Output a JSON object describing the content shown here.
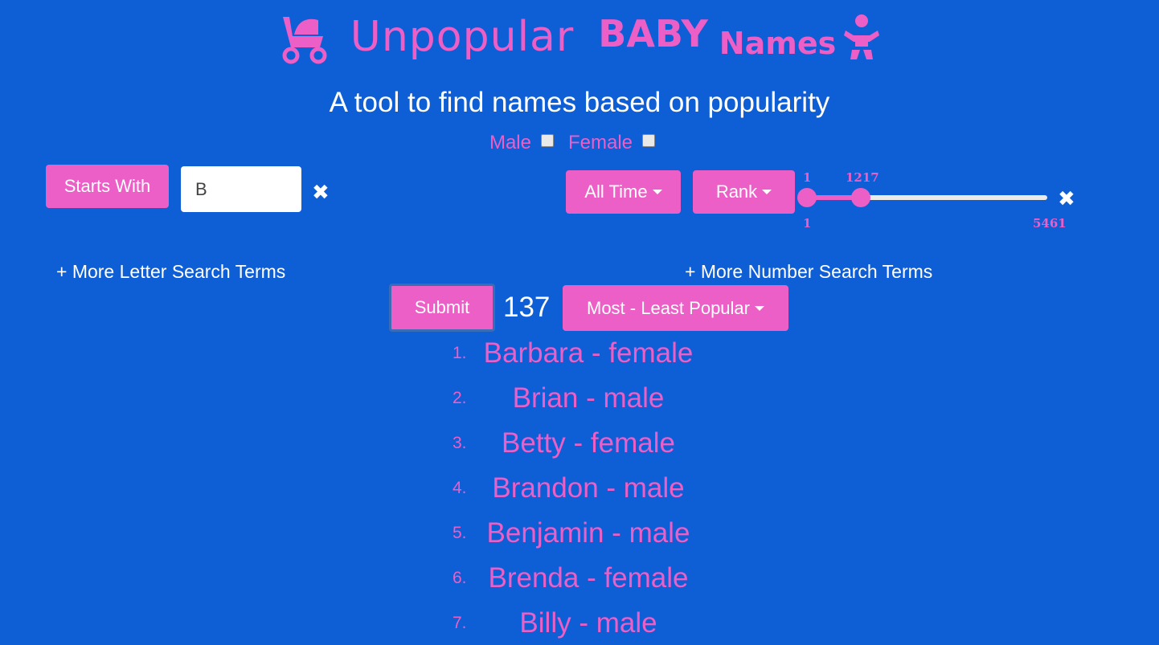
{
  "header": {
    "logo_word1": "Unpopular",
    "logo_word2": "BABY",
    "logo_word3": "Names",
    "subtitle": "A tool to find names based on popularity"
  },
  "gender": {
    "male_label": "Male",
    "female_label": "Female",
    "male_checked": false,
    "female_checked": false
  },
  "letter_search": {
    "mode_label": "Starts With",
    "value": "B",
    "clear_icon": "✖",
    "more_link": "+ More Letter Search Terms"
  },
  "number_search": {
    "period_label": "All Time",
    "metric_label": "Rank",
    "range_low": "1",
    "range_high": "1217",
    "min": "1",
    "max": "5461",
    "clear_icon": "✖",
    "more_link": "+ More Number Search Terms"
  },
  "actions": {
    "submit_label": "Submit",
    "result_count": "137",
    "sort_label": "Most - Least Popular"
  },
  "results": [
    {
      "index": "1.",
      "text": "Barbara - female"
    },
    {
      "index": "2.",
      "text": "Brian - male"
    },
    {
      "index": "3.",
      "text": "Betty - female"
    },
    {
      "index": "4.",
      "text": "Brandon - male"
    },
    {
      "index": "5.",
      "text": "Benjamin - male"
    },
    {
      "index": "6.",
      "text": "Brenda - female"
    },
    {
      "index": "7.",
      "text": "Billy - male"
    }
  ],
  "colors": {
    "background": "#0e5ed6",
    "accent": "#ec5fc6",
    "text": "#ffffff"
  },
  "icons": {
    "stroller": "stroller-icon",
    "baby": "baby-icon",
    "clear": "close-icon",
    "caret": "caret-down-icon"
  }
}
